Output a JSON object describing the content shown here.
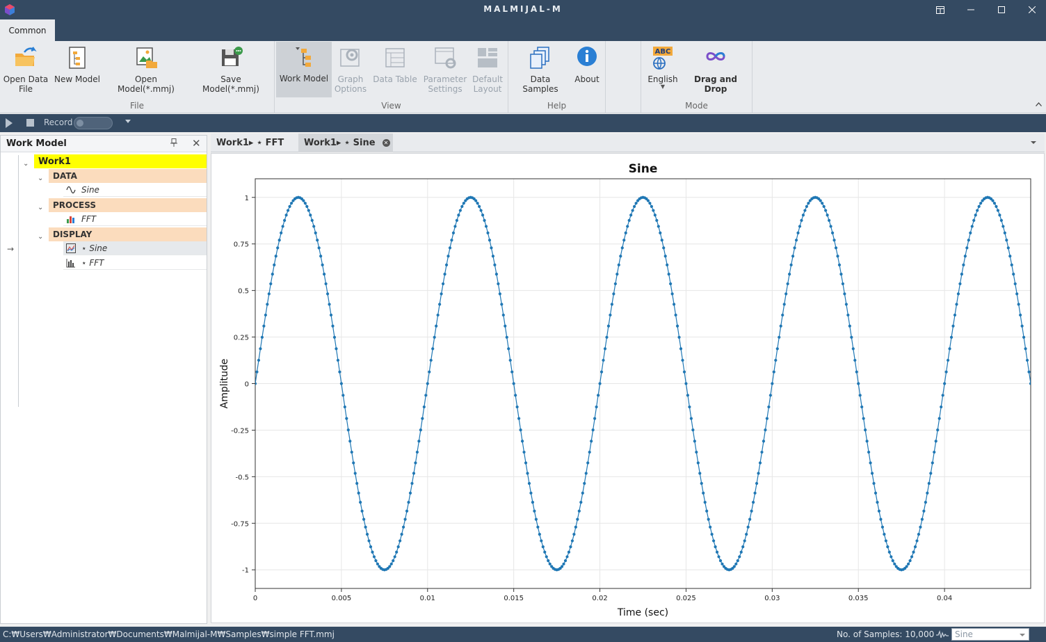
{
  "window": {
    "title": "MALMIJAL-M"
  },
  "ribbon": {
    "tab_label": "Common",
    "groups": {
      "file": {
        "label": "File",
        "open_data_file_l1": "Open Data",
        "open_data_file_l2": "File",
        "new_model": "New Model",
        "open_model": "Open Model(*.mmj)",
        "save_model": "Save Model(*.mmj)"
      },
      "view": {
        "label": "View",
        "work_model": "Work Model",
        "graph_options_l1": "Graph",
        "graph_options_l2": "Options",
        "data_table": "Data Table",
        "parameter_settings_l1": "Parameter",
        "parameter_settings_l2": "Settings",
        "default_layout_l1": "Default",
        "default_layout_l2": "Layout"
      },
      "help": {
        "label": "Help",
        "data_samples": "Data Samples",
        "about": "About"
      },
      "mode": {
        "label": "Mode",
        "english": "English",
        "english_badge": "ABC",
        "drag_and_drop": "Drag and Drop"
      }
    }
  },
  "recorder": {
    "label": "Record"
  },
  "work_model_panel": {
    "title": "Work Model",
    "root": "Work1",
    "sections": {
      "data": {
        "label": "DATA",
        "items": [
          "Sine"
        ]
      },
      "process": {
        "label": "PROCESS",
        "items": [
          "FFT"
        ]
      },
      "display": {
        "label": "DISPLAY",
        "items": [
          "⋆ Sine",
          "⋆ FFT"
        ]
      }
    }
  },
  "doc_tabs": [
    {
      "label": "Work1▸ ⋆ FFT"
    },
    {
      "label": "Work1▸ ⋆ Sine"
    }
  ],
  "chart_data": {
    "type": "line",
    "title": "Sine",
    "xlabel": "Time (sec)",
    "ylabel": "Amplitude",
    "xlim": [
      0,
      0.045
    ],
    "ylim": [
      -1.1,
      1.1
    ],
    "x_ticks": [
      "0",
      "0.005",
      "0.01",
      "0.015",
      "0.02",
      "0.025",
      "0.03",
      "0.035",
      "0.04"
    ],
    "y_ticks": [
      "1",
      "0.75",
      "0.5",
      "0.25",
      "0",
      "-0.25",
      "-0.5",
      "-0.75",
      "-1"
    ],
    "frequency_hz": 100,
    "sample_interval_sec": 0.0001,
    "grid": true,
    "series": [
      {
        "color": "#1f77b4"
      }
    ]
  },
  "status": {
    "path": "C:₩Users₩Administrator₩Documents₩Malmijal-M₩Samples₩simple FFT.mmj",
    "samples": "No. of Samples: 10,000",
    "selected_series": "Sine"
  }
}
